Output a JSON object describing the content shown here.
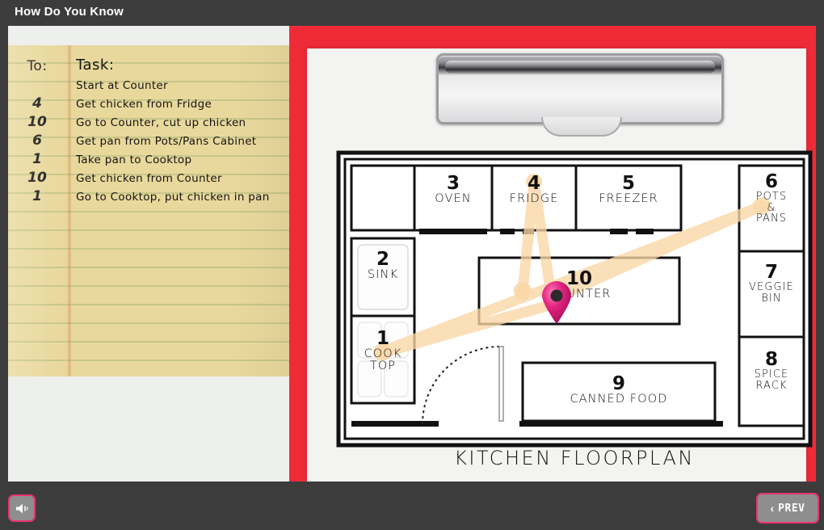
{
  "window": {
    "title": "How Do You Know"
  },
  "notepad": {
    "header": {
      "to": "To:",
      "task": "Task:"
    },
    "rows": [
      {
        "to": "",
        "task": "Start at Counter"
      },
      {
        "to": "4",
        "task": "Get chicken from Fridge"
      },
      {
        "to": "10",
        "task": "Go to Counter, cut up chicken"
      },
      {
        "to": "6",
        "task": "Get pan from Pots/Pans Cabinet"
      },
      {
        "to": "1",
        "task": "Take pan to Cooktop"
      },
      {
        "to": "10",
        "task": "Get chicken from Counter"
      },
      {
        "to": "1",
        "task": "Go to Cooktop, put chicken in pan"
      }
    ]
  },
  "floorplan": {
    "title": "KITCHEN FLOORPLAN",
    "current_location": "10",
    "stations": [
      {
        "num": "1",
        "name": "COOK\nTOP",
        "name_line1": "COOK",
        "name_line2": "TOP"
      },
      {
        "num": "2",
        "name": "SINK",
        "name_line1": "SINK",
        "name_line2": ""
      },
      {
        "num": "3",
        "name": "OVEN",
        "name_line1": "OVEN",
        "name_line2": ""
      },
      {
        "num": "4",
        "name": "FRIDGE",
        "name_line1": "FRIDGE",
        "name_line2": ""
      },
      {
        "num": "5",
        "name": "FREEZER",
        "name_line1": "FREEZER",
        "name_line2": ""
      },
      {
        "num": "6",
        "name": "POTS & PANS",
        "name_line1": "POTS",
        "name_line2": "&",
        "name_line3": "PANS"
      },
      {
        "num": "7",
        "name": "VEGGIE BIN",
        "name_line1": "VEGGIE",
        "name_line2": "BIN"
      },
      {
        "num": "8",
        "name": "SPICE RACK",
        "name_line1": "SPICE",
        "name_line2": "RACK"
      },
      {
        "num": "9",
        "name": "CANNED FOOD",
        "name_line1": "CANNED FOOD",
        "name_line2": ""
      },
      {
        "num": "10",
        "name": "COUNTER",
        "name_line1": "COUNTER",
        "name_line2": ""
      }
    ],
    "path_order": [
      "10",
      "4",
      "10",
      "6",
      "1",
      "10",
      "1"
    ]
  },
  "controls": {
    "sound_label": "sound",
    "prev_label": "PREV",
    "prev_chevron": "‹"
  },
  "colors": {
    "titlebar": "#3c3c3c",
    "clipboard_red": "#ef2b38",
    "notepad_tan": "#e9d89c",
    "accent_pink": "#e8346e",
    "path_orange": "#fad7a6",
    "pin_pink": "#d81b7b"
  }
}
